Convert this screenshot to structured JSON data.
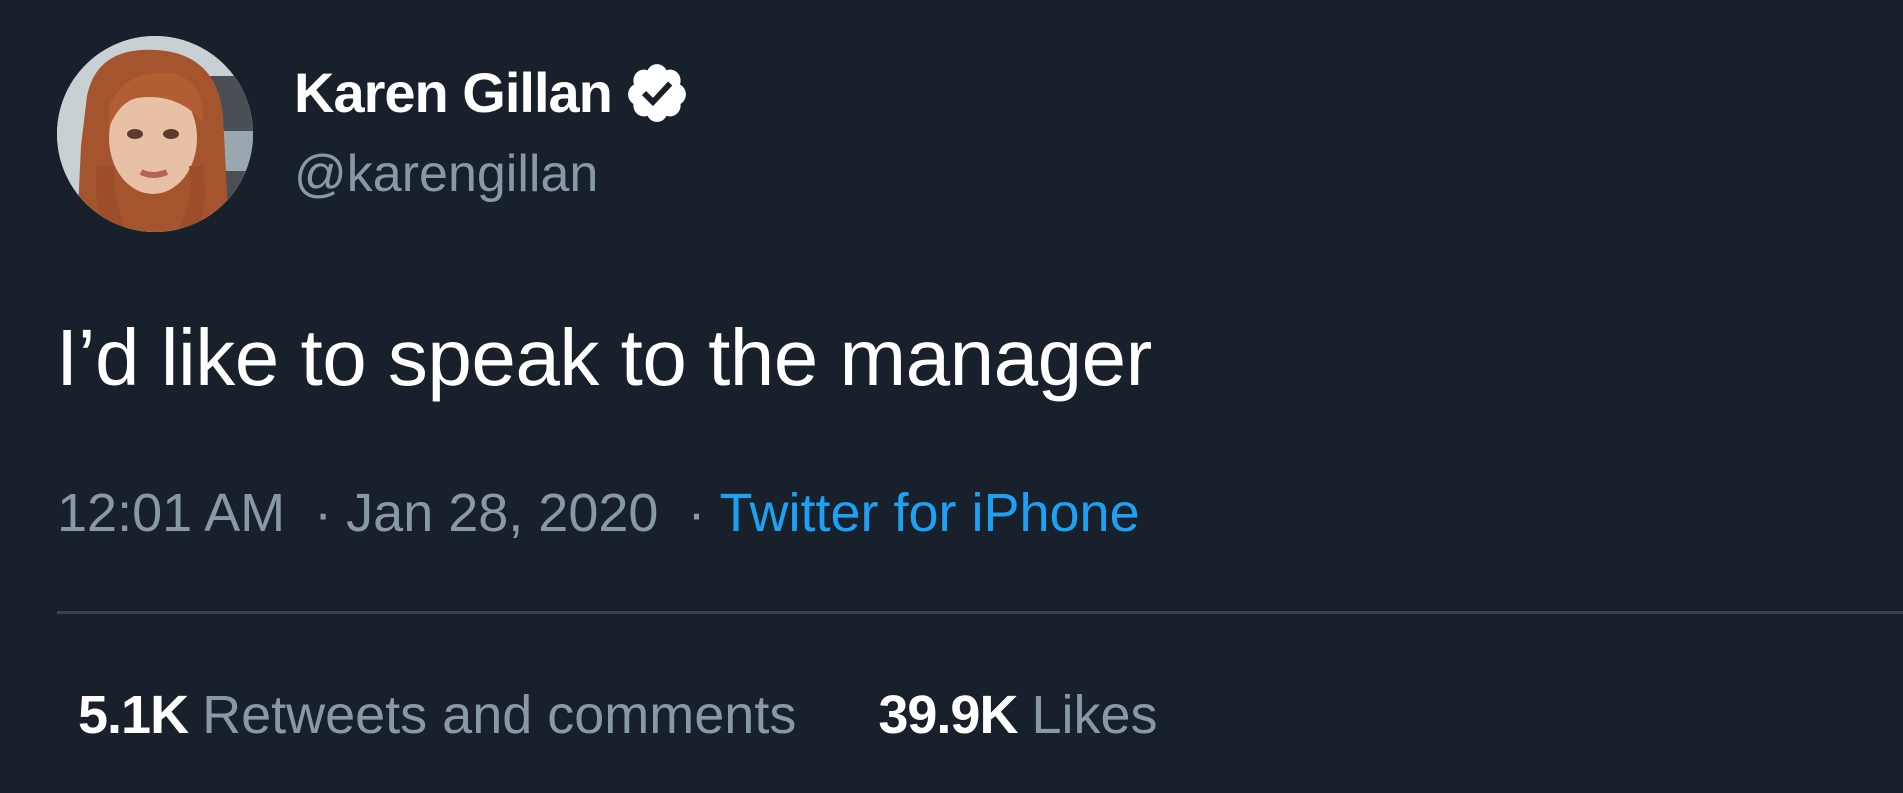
{
  "author": {
    "display_name": "Karen Gillan",
    "handle": "@karengillan",
    "verified_icon": "verified-badge-icon",
    "avatar": "profile-photo"
  },
  "tweet": {
    "text": "I’d like to speak to the manager",
    "time": "12:01 AM",
    "date": "Jan 28, 2020",
    "separator": "·",
    "source": "Twitter for iPhone"
  },
  "stats": {
    "retweets_count": "5.1K",
    "retweets_label": "Retweets and comments",
    "likes_count": "39.9K",
    "likes_label": "Likes"
  },
  "colors": {
    "background": "#18202b",
    "primary_text": "#ffffff",
    "secondary_text": "#8899a6",
    "accent": "#1da1f2",
    "divider": "#38444d"
  }
}
